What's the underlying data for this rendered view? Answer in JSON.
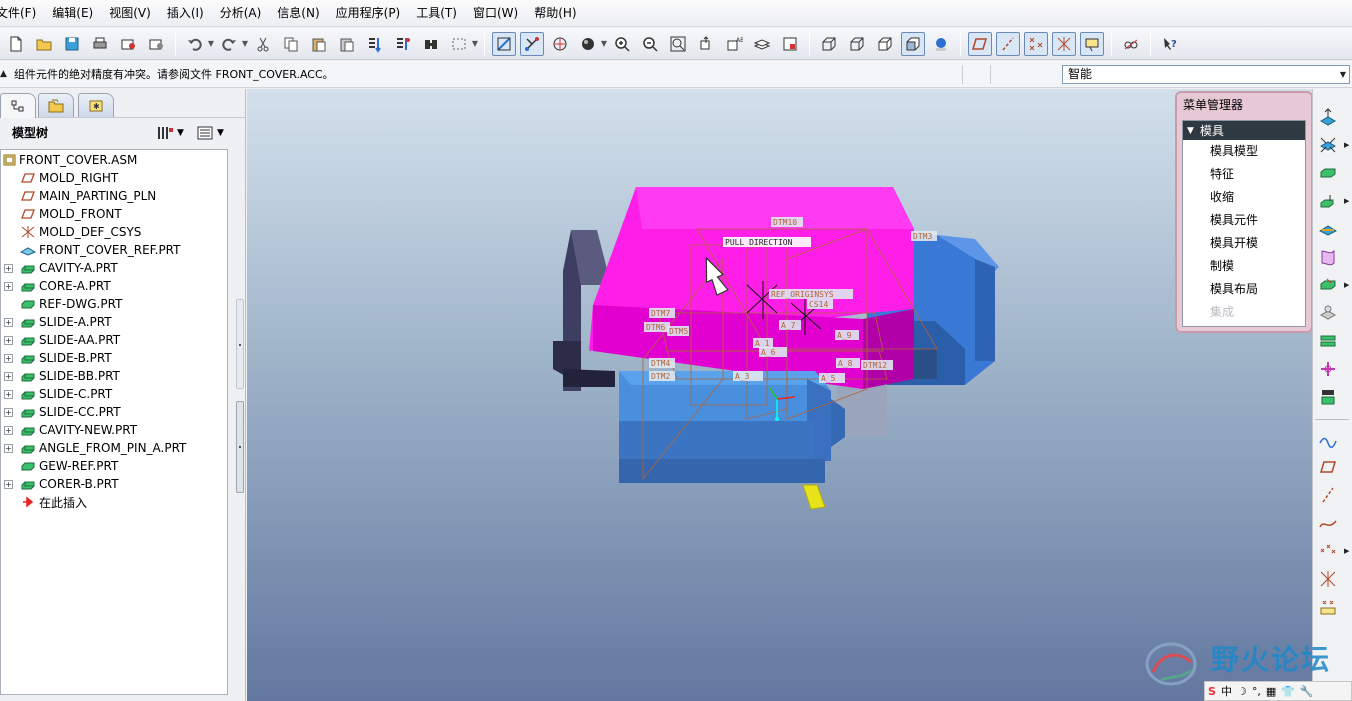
{
  "menubar": {
    "items": [
      "文件(F)",
      "编辑(E)",
      "视图(V)",
      "插入(I)",
      "分析(A)",
      "信息(N)",
      "应用程序(P)",
      "工具(T)",
      "窗口(W)",
      "帮助(H)"
    ]
  },
  "toolbar": {
    "icons": [
      "new-icon",
      "open-icon",
      "save-icon",
      "print-icon",
      "email-icon",
      "email-link-icon",
      "undo-icon",
      "redo-icon",
      "cut-icon",
      "copy-icon",
      "paste-icon",
      "paste-special-icon",
      "regenerate-icon",
      "regen-manager-icon",
      "find-icon",
      "select-box-icon",
      "spin-center-icon",
      "datum-display-icon",
      "orient-icon",
      "shading-icon",
      "zoom-in-icon",
      "zoom-out-icon",
      "refit-icon",
      "reorient-icon",
      "saved-views-icon",
      "layers-icon",
      "view-manager-icon",
      "wireframe-icon",
      "hidden-line-icon",
      "no-hidden-icon",
      "shaded-icon",
      "enhanced-realism-icon",
      "plane-display-icon",
      "axis-display-icon",
      "point-display-icon",
      "csys-display-icon",
      "annotation-display-icon",
      "glasses-icon",
      "context-help-icon"
    ]
  },
  "message": {
    "text": "组件元件的绝对精度有冲突。请参阅文件 FRONT_COVER.ACC。"
  },
  "filter": {
    "value": "智能"
  },
  "left_panel": {
    "tree_title": "模型树",
    "items": [
      {
        "label": "FRONT_COVER.ASM",
        "icon": "assembly-icon",
        "expandable": false
      },
      {
        "label": "MOLD_RIGHT",
        "icon": "datum-plane-icon",
        "expandable": false
      },
      {
        "label": "MAIN_PARTING_PLN",
        "icon": "datum-plane-icon",
        "expandable": false
      },
      {
        "label": "MOLD_FRONT",
        "icon": "datum-plane-icon",
        "expandable": false
      },
      {
        "label": "MOLD_DEF_CSYS",
        "icon": "csys-icon",
        "expandable": false
      },
      {
        "label": "FRONT_COVER_REF.PRT",
        "icon": "ref-part-icon",
        "expandable": false
      },
      {
        "label": "CAVITY-A.PRT",
        "icon": "part-icon",
        "expandable": true
      },
      {
        "label": "CORE-A.PRT",
        "icon": "part-icon",
        "expandable": true
      },
      {
        "label": "REF-DWG.PRT",
        "icon": "workpiece-icon",
        "expandable": false
      },
      {
        "label": "SLIDE-A.PRT",
        "icon": "part-icon",
        "expandable": true
      },
      {
        "label": "SLIDE-AA.PRT",
        "icon": "part-icon",
        "expandable": true
      },
      {
        "label": "SLIDE-B.PRT",
        "icon": "part-icon",
        "expandable": true
      },
      {
        "label": "SLIDE-BB.PRT",
        "icon": "part-icon",
        "expandable": true
      },
      {
        "label": "SLIDE-C.PRT",
        "icon": "part-icon",
        "expandable": true
      },
      {
        "label": "SLIDE-CC.PRT",
        "icon": "part-icon",
        "expandable": true
      },
      {
        "label": "CAVITY-NEW.PRT",
        "icon": "part-icon",
        "expandable": true
      },
      {
        "label": "ANGLE_FROM_PIN_A.PRT",
        "icon": "part-icon",
        "expandable": true
      },
      {
        "label": "GEW-REF.PRT",
        "icon": "workpiece-icon",
        "expandable": false
      },
      {
        "label": "CORER-B.PRT",
        "icon": "part-icon",
        "expandable": true
      },
      {
        "label": "在此插入",
        "icon": "insert-here-icon",
        "expandable": false
      }
    ]
  },
  "viewport": {
    "labels": {
      "pull_direction": "PULL DIRECTION",
      "dtm10": "DTM10",
      "dtm3": "DTM3",
      "dtm7": "DTM7",
      "dtm6": "DTM6",
      "dtm4": "DTM4",
      "dtm2": "DTM2",
      "dtm12": "DTM12",
      "dtm5": "DTM5",
      "ref_origin": "REF_ORIGINSYS",
      "cs14": "CS14",
      "a7": "A_7",
      "a1": "A_1",
      "a9": "A_9",
      "a3": "A_3",
      "a6": "A_6",
      "a8": "A_8",
      "a5": "A_5"
    }
  },
  "menu_manager": {
    "title": "菜单管理器",
    "header": "模具",
    "items": [
      {
        "label": "模具模型",
        "enabled": true
      },
      {
        "label": "特征",
        "enabled": true
      },
      {
        "label": "收缩",
        "enabled": true
      },
      {
        "label": "模具元件",
        "enabled": true
      },
      {
        "label": "模具开模",
        "enabled": true
      },
      {
        "label": "制模",
        "enabled": true
      },
      {
        "label": "模具布局",
        "enabled": true
      },
      {
        "label": "集成",
        "enabled": false
      }
    ]
  },
  "right_toolbar": {
    "icons": [
      "mold-model-icon",
      "reference-model-icon",
      "workpiece-icon",
      "slider-icon",
      "shrink-icon",
      "parting-surface-icon",
      "volume-icon",
      "extract-icon",
      "sprue-icon",
      "runner-icon",
      "mold-opening-icon",
      "sketch-icon",
      "datum-plane-icon",
      "datum-axis-icon",
      "datum-curve-icon",
      "datum-point-icon",
      "csys-icon",
      "analysis-feature-icon"
    ]
  },
  "watermark": {
    "text": "野火论坛"
  },
  "tray": {
    "items": [
      "S",
      "中",
      "☽",
      "°,",
      "▦",
      "👕",
      "🔧"
    ]
  }
}
